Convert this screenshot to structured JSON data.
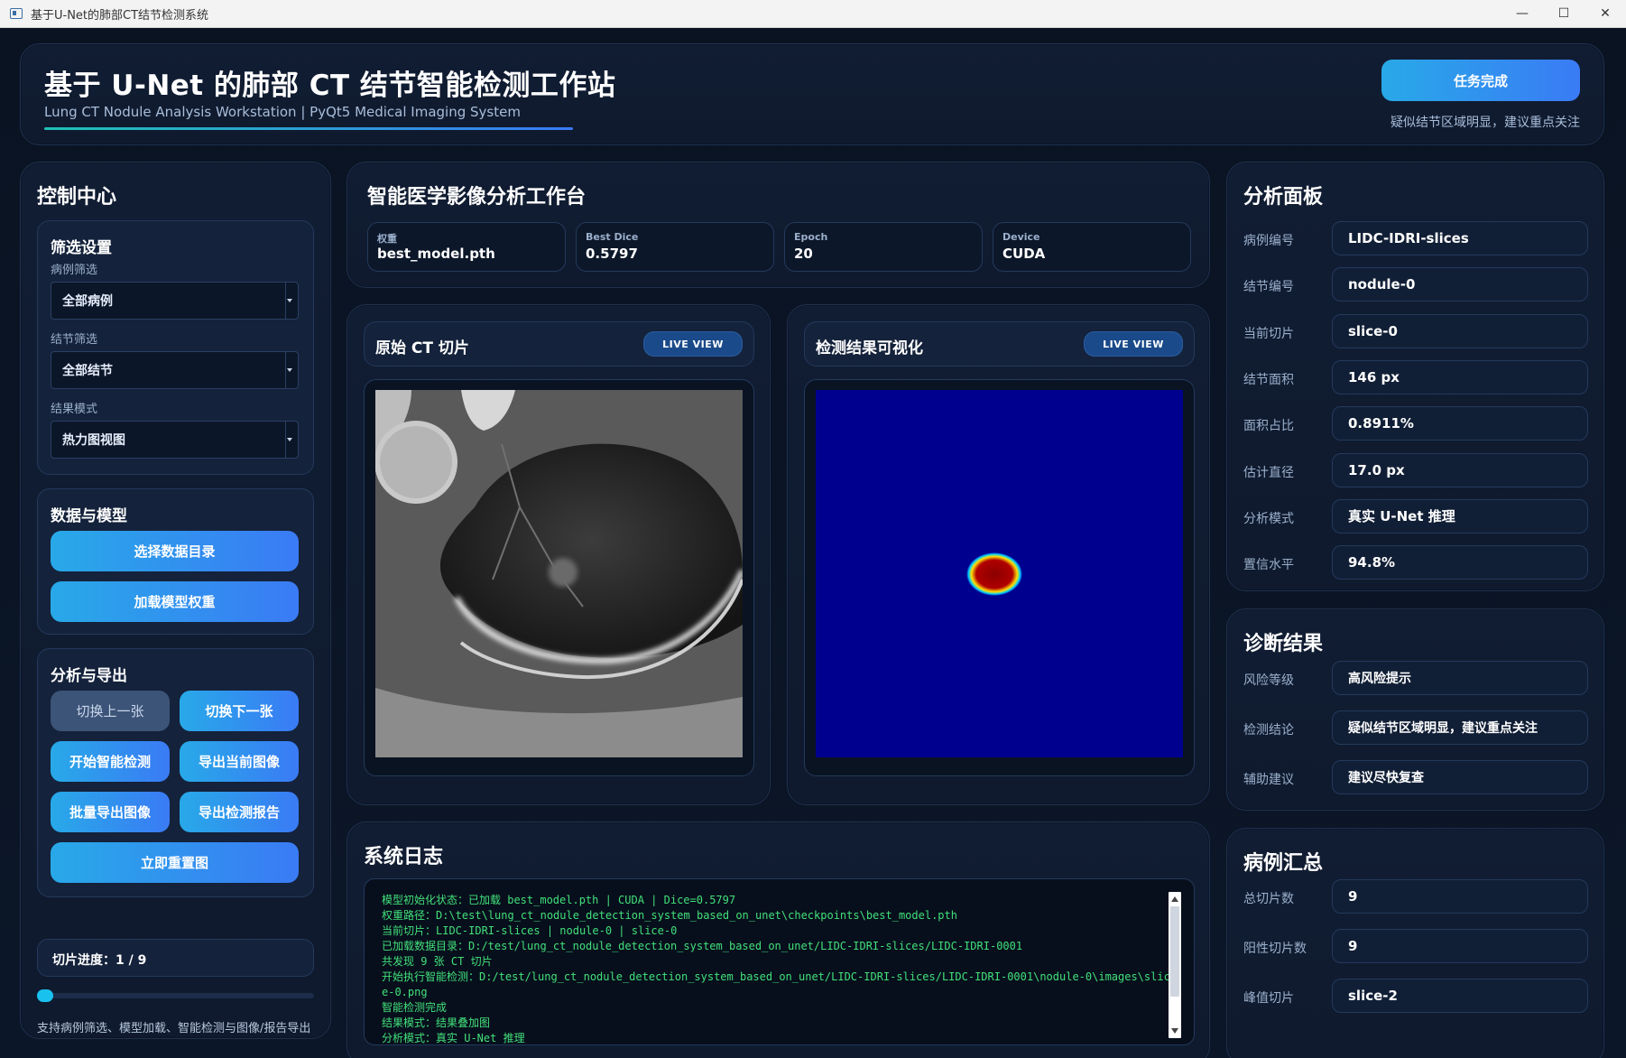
{
  "window": {
    "title": "基于U-Net的肺部CT结节检测系统",
    "minimize": "—",
    "maximize": "☐",
    "close": "✕"
  },
  "header": {
    "title": "基于 U-Net 的肺部 CT 结节智能检测工作站",
    "subtitle": "Lung CT Nodule Analysis Workstation | PyQt5 Medical Imaging System",
    "task_button": "任务完成",
    "status_text": "疑似结节区域明显，建议重点关注"
  },
  "control": {
    "title": "控制中心",
    "filter": {
      "title": "筛选设置",
      "case_label": "病例筛选",
      "case_value": "全部病例",
      "nodule_label": "结节筛选",
      "nodule_value": "全部结节",
      "mode_label": "结果模式",
      "mode_value": "热力图视图"
    },
    "data_model": {
      "title": "数据与模型",
      "select_dir": "选择数据目录",
      "load_weights": "加载模型权重"
    },
    "analysis": {
      "title": "分析与导出",
      "prev": "切换上一张",
      "next": "切换下一张",
      "detect": "开始智能检测",
      "export_image": "导出当前图像",
      "batch_export": "批量导出图像",
      "export_report": "导出检测报告",
      "reset": "立即重置图"
    },
    "progress": {
      "label": "切片进度：1 / 9",
      "current": 1,
      "total": 9
    },
    "footnote": "支持病例筛选、模型加载、智能检测与图像/报告导出"
  },
  "workbench": {
    "title": "智能医学影像分析工作台",
    "chips": [
      {
        "key": "权重",
        "value": "best_model.pth"
      },
      {
        "key": "Best Dice",
        "value": "0.5797"
      },
      {
        "key": "Epoch",
        "value": "20"
      },
      {
        "key": "Device",
        "value": "CUDA"
      }
    ]
  },
  "views": {
    "original": {
      "title": "原始 CT 切片",
      "badge": "LIVE VIEW"
    },
    "result": {
      "title": "检测结果可视化",
      "badge": "LIVE VIEW"
    }
  },
  "log": {
    "title": "系统日志",
    "lines": [
      "模型初始化状态：已加载 best_model.pth | CUDA | Dice=0.5797",
      "权重路径：D:\\test\\lung_ct_nodule_detection_system_based_on_unet\\checkpoints\\best_model.pth",
      "当前切片：LIDC-IDRI-slices | nodule-0 | slice-0",
      "已加载数据目录：D:/test/lung_ct_nodule_detection_system_based_on_unet/LIDC-IDRI-slices/LIDC-IDRI-0001",
      "共发现 9 张 CT 切片",
      "开始执行智能检测：D:/test/lung_ct_nodule_detection_system_based_on_unet/LIDC-IDRI-slices/LIDC-IDRI-0001\\nodule-0\\images\\slice-0.png",
      "智能检测完成",
      "结果模式：结果叠加图",
      "分析模式：真实 U-Net 推理"
    ]
  },
  "analysis_panel": {
    "title": "分析面板",
    "rows": [
      {
        "label": "病例编号",
        "value": "LIDC-IDRI-slices"
      },
      {
        "label": "结节编号",
        "value": "nodule-0"
      },
      {
        "label": "当前切片",
        "value": "slice-0"
      },
      {
        "label": "结节面积",
        "value": "146 px"
      },
      {
        "label": "面积占比",
        "value": "0.8911%"
      },
      {
        "label": "估计直径",
        "value": "17.0 px"
      },
      {
        "label": "分析模式",
        "value": "真实 U-Net 推理"
      },
      {
        "label": "置信水平",
        "value": "94.8%"
      }
    ]
  },
  "diagnosis": {
    "title": "诊断结果",
    "rows": [
      {
        "label": "风险等级",
        "value": "高风险提示"
      },
      {
        "label": "检测结论",
        "value": "疑似结节区域明显，建议重点关注"
      },
      {
        "label": "辅助建议",
        "value": "建议尽快复查"
      }
    ]
  },
  "summary": {
    "title": "病例汇总",
    "rows": [
      {
        "label": "总切片数",
        "value": "9"
      },
      {
        "label": "阳性切片数",
        "value": "9"
      },
      {
        "label": "峰值切片",
        "value": "slice-2"
      }
    ]
  }
}
